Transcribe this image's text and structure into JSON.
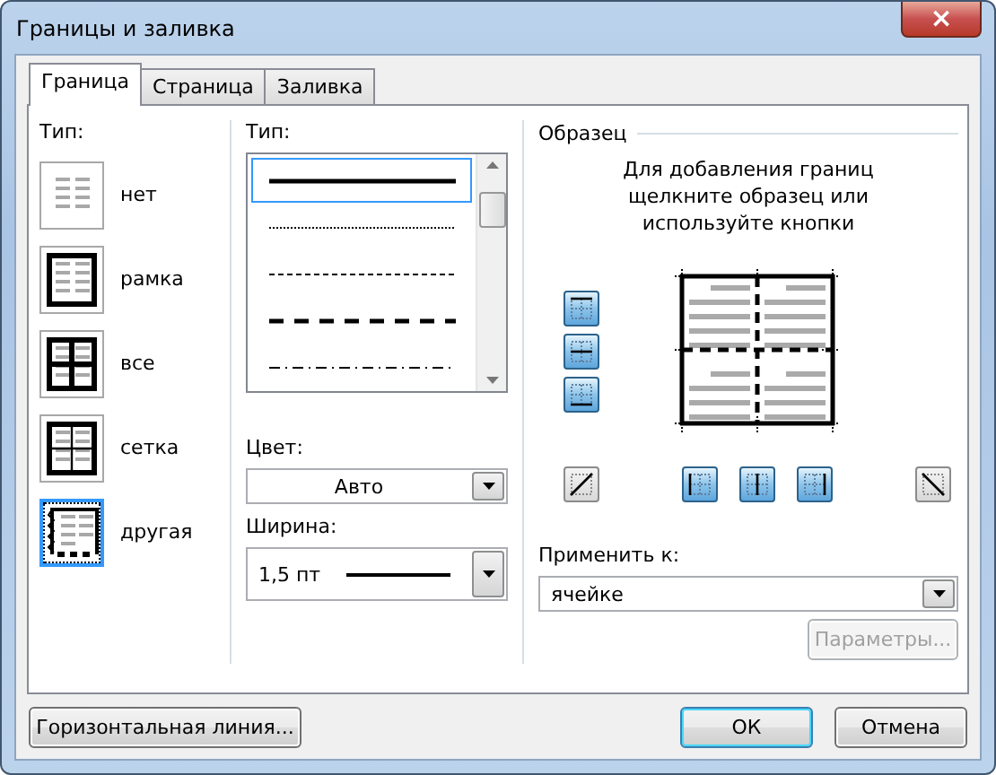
{
  "window": {
    "title": "Границы и заливка",
    "close": "×"
  },
  "tabs": [
    {
      "label": "Граница",
      "selected": true
    },
    {
      "label": "Страница",
      "selected": false
    },
    {
      "label": "Заливка",
      "selected": false
    }
  ],
  "presets": {
    "label": "Тип:",
    "items": [
      {
        "kind": "none",
        "label": "нет",
        "selected": false
      },
      {
        "kind": "box",
        "label": "рамка",
        "selected": false
      },
      {
        "kind": "all",
        "label": "все",
        "selected": false
      },
      {
        "kind": "grid",
        "label": "сетка",
        "selected": false
      },
      {
        "kind": "custom",
        "label": "другая",
        "selected": true
      }
    ]
  },
  "styles": {
    "label": "Тип:",
    "items": [
      {
        "kind": "solid",
        "selected": true
      },
      {
        "kind": "dotted",
        "selected": false
      },
      {
        "kind": "dashed",
        "selected": false
      },
      {
        "kind": "long-dash",
        "selected": false
      },
      {
        "kind": "dash-dot",
        "selected": false
      }
    ]
  },
  "color": {
    "label": "Цвет:",
    "value": "Авто"
  },
  "width": {
    "label": "Ширина:",
    "value": "1,5 пт"
  },
  "preview": {
    "label": "Образец",
    "hint": "Для добавления границ щелкните образец или используйте кнопки",
    "side_buttons": [
      {
        "kind": "top",
        "on": true
      },
      {
        "kind": "middle-h",
        "on": true
      },
      {
        "kind": "bottom",
        "on": true
      }
    ],
    "bottom_buttons": [
      {
        "kind": "diag-up",
        "on": false
      },
      {
        "kind": "left",
        "on": true
      },
      {
        "kind": "middle-v",
        "on": true
      },
      {
        "kind": "right",
        "on": true
      },
      {
        "kind": "diag-down",
        "on": false
      }
    ]
  },
  "apply_to": {
    "label": "Применить к:",
    "value": "ячейке"
  },
  "options_button": {
    "label": "Параметры...",
    "disabled": true
  },
  "horizontal_line_button": {
    "label": "Горизонтальная линия..."
  },
  "buttons": [
    {
      "label": "ОК",
      "default": true
    },
    {
      "label": "Отмена",
      "default": false
    }
  ]
}
